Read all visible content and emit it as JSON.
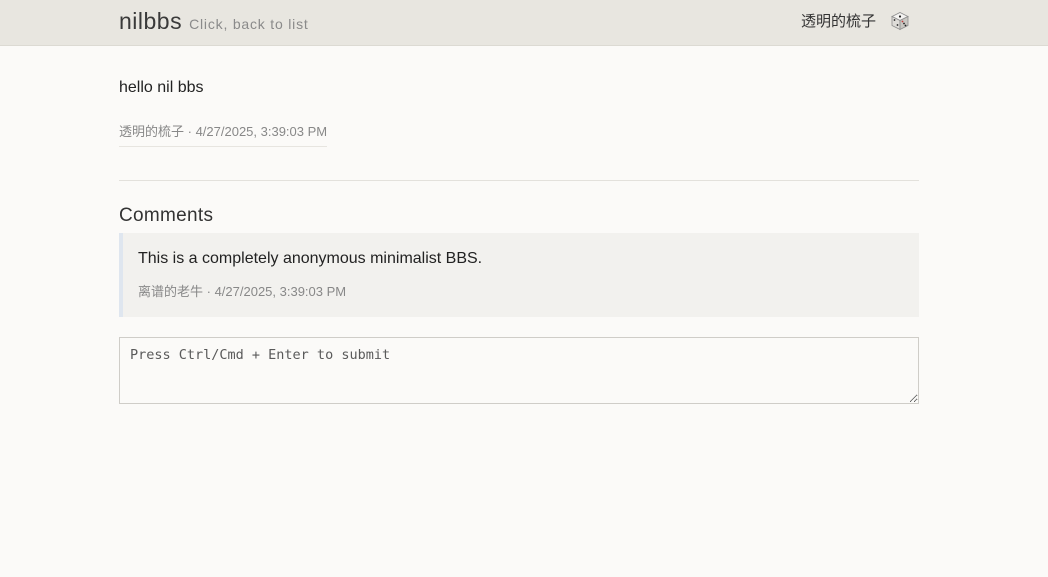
{
  "header": {
    "title": "nilbbs",
    "subtitle": "Click, back to list",
    "username": "透明的梳子",
    "dice_icon": "dice-icon"
  },
  "post": {
    "body": "hello nil bbs",
    "author": "透明的梳子",
    "separator": " · ",
    "timestamp": "4/27/2025, 3:39:03 PM"
  },
  "comments": {
    "title": "Comments",
    "items": [
      {
        "text": "This is a completely anonymous minimalist BBS.",
        "author": "离谱的老牛",
        "separator": " · ",
        "timestamp": "4/27/2025, 3:39:03 PM"
      }
    ]
  },
  "composer": {
    "placeholder": "Press Ctrl/Cmd + Enter to submit",
    "value": ""
  },
  "colors": {
    "header_bg": "#e8e6e0",
    "page_bg": "#fbfaf8",
    "comment_bg": "#f2f1ee",
    "comment_border": "#dfe6ef"
  }
}
